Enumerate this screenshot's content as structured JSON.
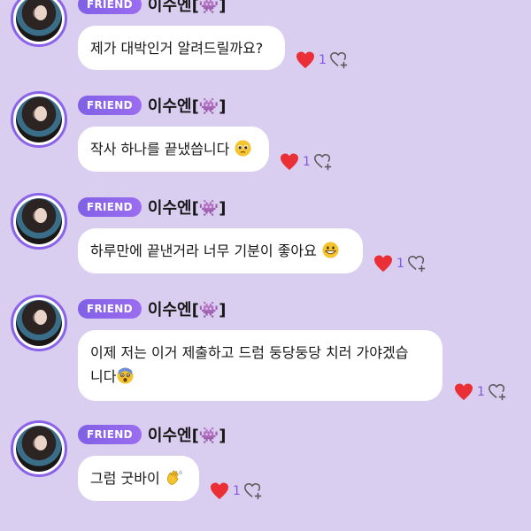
{
  "colors": {
    "background": "#d9cdf0",
    "accent": "#8a63e8",
    "heart": "#ea2f37",
    "bubble": "#ffffff"
  },
  "messages": [
    {
      "badge": "FRIEND",
      "sender": "이수엔[👾]",
      "text": "제가 대박인거 알려드릴까요?",
      "emoji_icon": "",
      "like_count": "1"
    },
    {
      "badge": "FRIEND",
      "sender": "이수엔[👾]",
      "text": "작사 하나를 끝냈씁니다",
      "emoji_icon": "pleading-face-icon",
      "like_count": "1"
    },
    {
      "badge": "FRIEND",
      "sender": "이수엔[👾]",
      "text": "하루만에 끝낸거라 너무 기분이 좋아요",
      "emoji_icon": "grinning-face-icon",
      "like_count": "1"
    },
    {
      "badge": "FRIEND",
      "sender": "이수엔[👾]",
      "text_lines": [
        "이제 저는 이거 제출하고 드럼 둥당둥당 치러 가야겠습",
        "니다"
      ],
      "emoji_icon": "fearful-face-icon",
      "like_count": "1"
    },
    {
      "badge": "FRIEND",
      "sender": "이수엔[👾]",
      "text": "그럼 굿바이",
      "emoji_icon": "waving-hand-icon",
      "like_count": "1"
    }
  ]
}
